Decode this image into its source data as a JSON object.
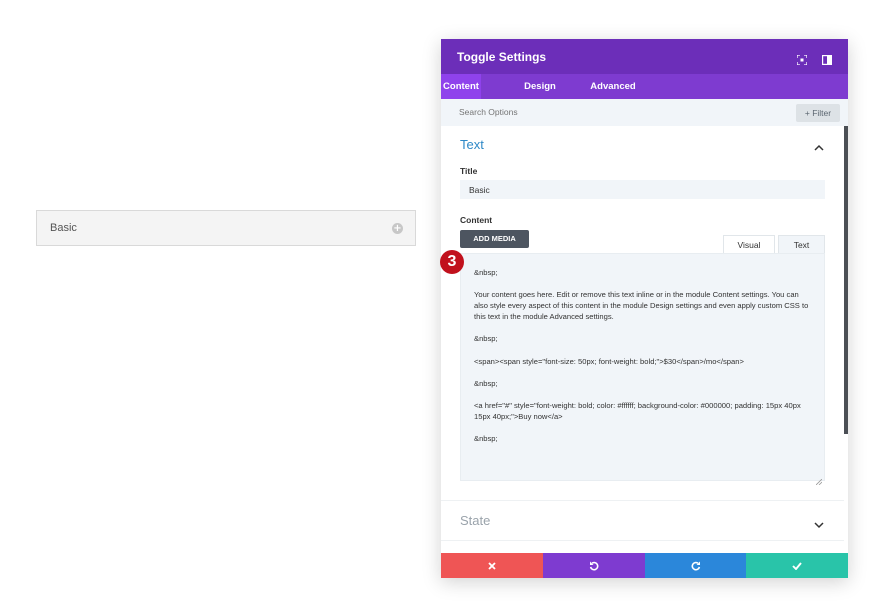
{
  "preview": {
    "label": "Basic"
  },
  "modal": {
    "title": "Toggle Settings",
    "tabs": [
      "Content",
      "Design",
      "Advanced"
    ],
    "search_placeholder": "Search Options",
    "filter_label": "+ Filter",
    "section_text": "Text",
    "title_label": "Title",
    "title_value": "Basic",
    "content_label": "Content",
    "add_media": "ADD MEDIA",
    "editor_tabs": [
      "Visual",
      "Text"
    ],
    "editor_lines": [
      "&nbsp;",
      "Your content goes here. Edit or remove this text inline or in the module Content settings. You can also style every aspect of this content in the module Design settings and even apply custom CSS to this text in the module Advanced settings.",
      "&nbsp;",
      "<span><span style=\"font-size: 50px; font-weight: bold;\">$30</span>/mo</span>",
      "&nbsp;",
      "<a href=\"#\" style=\"font-weight: bold; color: #ffffff; background-color: #000000; padding: 15px 40px 15px 40px;\">Buy now</a>",
      "&nbsp;"
    ],
    "section_state": "State"
  },
  "badge": "3",
  "colors": {
    "header": "#6c2eb9",
    "tabs": "#7e3bd0",
    "active_tab": "#8f42ec",
    "cancel": "#ef5555",
    "undo": "#7e3bd0",
    "redo": "#2b87da",
    "save": "#29c4a9",
    "badge": "#c1111d"
  },
  "footer_icons": [
    "close-icon",
    "undo-icon",
    "redo-icon",
    "check-icon"
  ]
}
